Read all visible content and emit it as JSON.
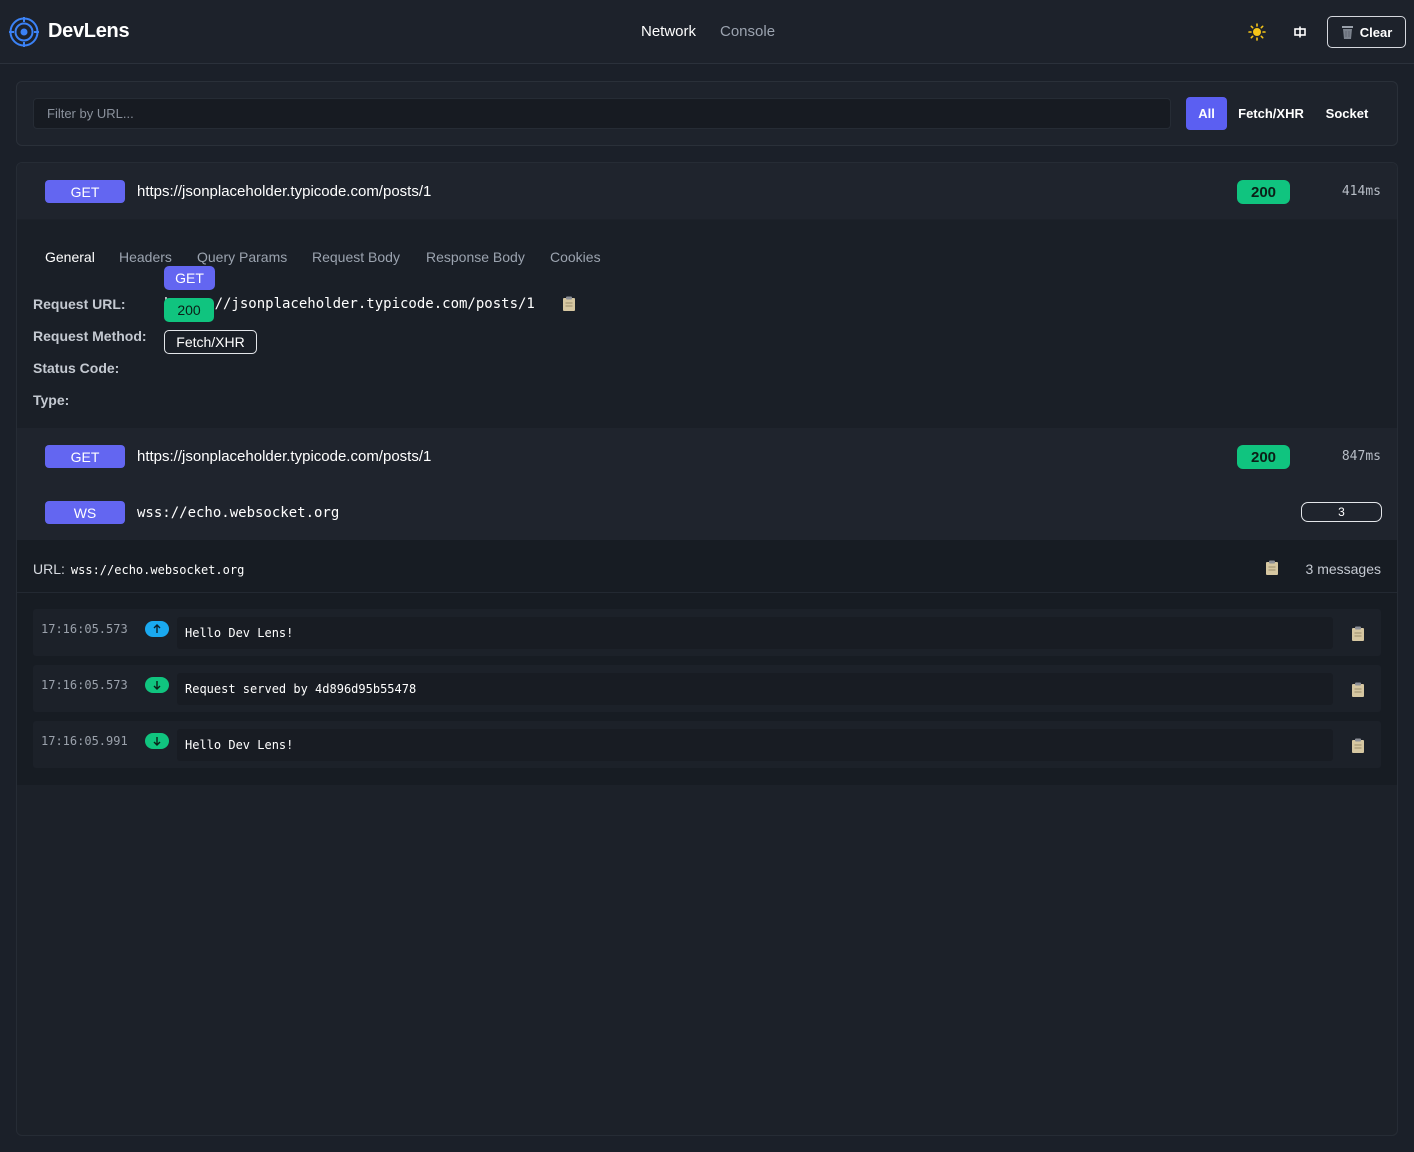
{
  "app": {
    "name": "DevLens"
  },
  "nav": {
    "tabs": [
      {
        "label": "Network",
        "active": true
      },
      {
        "label": "Console",
        "active": false
      }
    ]
  },
  "header": {
    "theme_icon": "sun-icon",
    "layout_icon": "split-layout-icon",
    "clear_label": "Clear",
    "clear_icon": "trash-icon"
  },
  "filter": {
    "placeholder": "Filter by URL...",
    "value": "",
    "types": [
      {
        "label": "All",
        "active": true
      },
      {
        "label": "Fetch/XHR",
        "active": false
      },
      {
        "label": "Socket",
        "active": false
      }
    ]
  },
  "requests": [
    {
      "method": "GET",
      "url": "https://jsonplaceholder.typicode.com/posts/1",
      "status": "200",
      "time": "414ms",
      "expanded": true
    },
    {
      "method": "GET",
      "url": "https://jsonplaceholder.typicode.com/posts/1",
      "status": "200",
      "time": "847ms",
      "expanded": false
    },
    {
      "method": "WS",
      "url": "wss://echo.websocket.org",
      "count": "3",
      "expanded": true
    }
  ],
  "details": {
    "tabs": [
      "General",
      "Headers",
      "Query Params",
      "Request Body",
      "Response Body",
      "Cookies"
    ],
    "active_tab": "General",
    "labels": {
      "request_url": "Request URL:",
      "request_method": "Request Method:",
      "status_code": "Status Code:",
      "type": "Type:"
    },
    "values": {
      "request_url": "https://jsonplaceholder.typicode.com/posts/1",
      "request_method": "GET",
      "status_code": "200",
      "type": "Fetch/XHR"
    }
  },
  "ws": {
    "url_label": "URL:",
    "url": "wss://echo.websocket.org",
    "count_label": "3 messages",
    "messages": [
      {
        "time": "17:16:05.573",
        "direction": "sent",
        "text": "Hello Dev Lens!"
      },
      {
        "time": "17:16:05.573",
        "direction": "received",
        "text": "Request served by 4d896d95b55478"
      },
      {
        "time": "17:16:05.991",
        "direction": "received",
        "text": "Hello Dev Lens!"
      }
    ]
  },
  "colors": {
    "accent": "#6366f1",
    "success": "#10c47f",
    "sent": "#1aa9f0",
    "background": "#1b2029"
  }
}
